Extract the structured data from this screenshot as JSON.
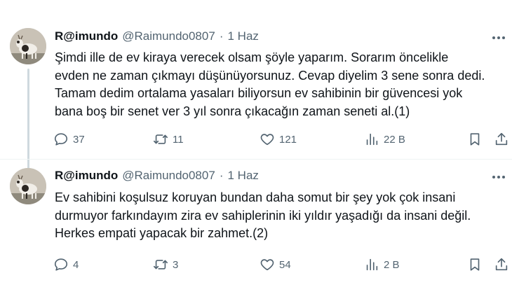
{
  "tweets": [
    {
      "name": "R@imundo",
      "handle": "@Raimundo0807",
      "separator": "·",
      "time": "1 Haz",
      "text_lines": [
        "Şimdi ille de ev kiraya verecek olsam şöyle yaparım. Sorarım öncelikle",
        "evden ne zaman çıkmayı düşünüyorsunuz. Cevap diyelim 3 sene sonra dedi.",
        "Tamam dedim ortalama yasaları biliyorsun ev sahibinin bir güvencesi yok",
        "bana boş bir senet ver 3 yıl sonra çıkacağın zaman seneti al.(1)"
      ],
      "replies": "37",
      "retweets": "11",
      "likes": "121",
      "views": "22 B"
    },
    {
      "name": "R@imundo",
      "handle": "@Raimundo0807",
      "separator": "·",
      "time": "1 Haz",
      "text_lines": [
        "Ev sahibini koşulsuz koruyan bundan daha somut bir şey yok çok insani",
        "durmuyor farkındayım zira ev sahiplerinin iki yıldır yaşadığı da insani değil.",
        "Herkes empati yapacak bir zahmet.(2)"
      ],
      "replies": "4",
      "retweets": "3",
      "likes": "54",
      "views": "2 B"
    }
  ],
  "icons": {
    "reply": "speech-bubble",
    "retweet": "two-arrows-loop",
    "like": "heart",
    "views": "bar-chart",
    "bookmark": "bookmark",
    "share": "upload-arrow",
    "more": "three-dots"
  },
  "colors": {
    "text": "#0f1419",
    "secondary": "#536471",
    "thread_line": "#cfd9de"
  }
}
